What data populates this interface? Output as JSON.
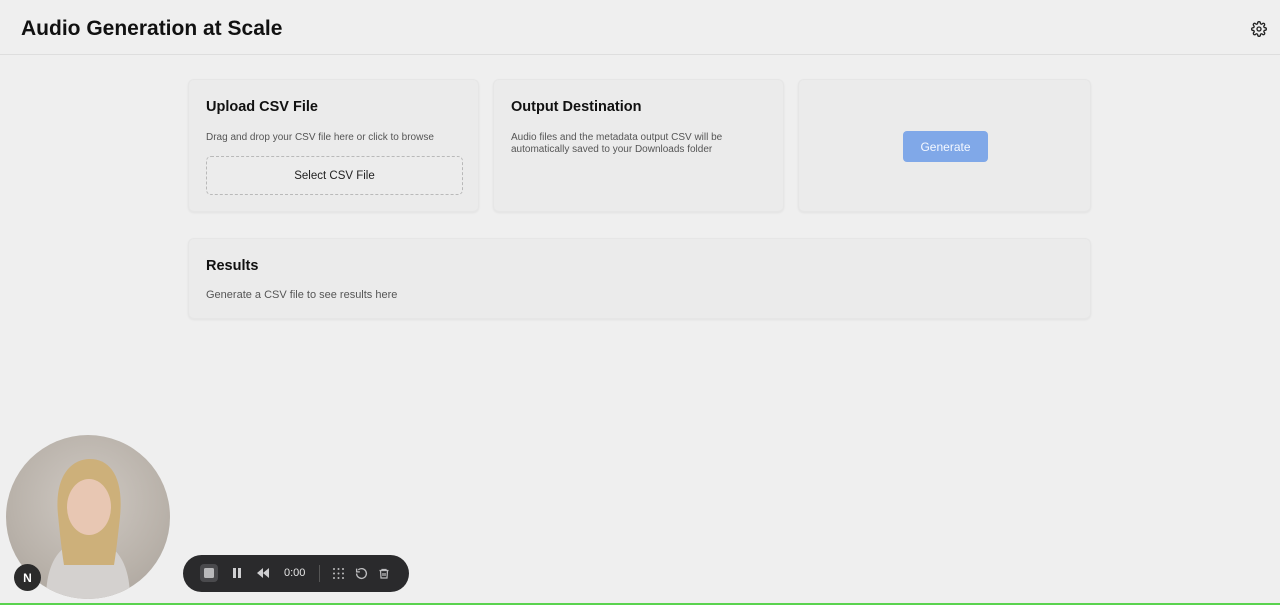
{
  "header": {
    "title": "Audio Generation at Scale",
    "settings_icon": "gear-icon"
  },
  "upload": {
    "title": "Upload CSV File",
    "description": "Drag and drop your CSV file here or click to browse",
    "button_label": "Select CSV File"
  },
  "output": {
    "title": "Output Destination",
    "description": "Audio files and the metadata output CSV will be automatically saved to your Downloads folder"
  },
  "generate": {
    "button_label": "Generate",
    "button_color": "#80a8e8"
  },
  "results": {
    "title": "Results",
    "empty_text": "Generate a CSV file to see results here"
  },
  "recorder": {
    "badge_letter": "N",
    "time": "0:00",
    "icons": [
      "stop-icon",
      "pause-icon",
      "rewind-icon",
      "grid-icon",
      "restart-icon",
      "trash-icon"
    ]
  },
  "colors": {
    "background": "#efefef",
    "card": "#ebebeb",
    "accent_green": "#5ad34e"
  }
}
